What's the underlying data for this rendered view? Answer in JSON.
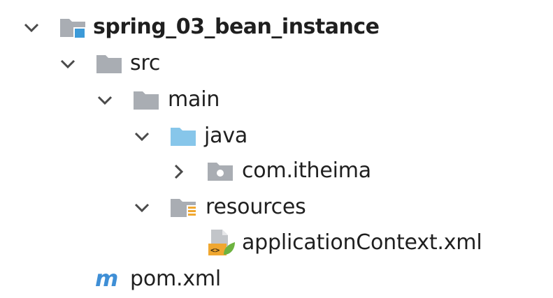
{
  "tree": {
    "root": {
      "label": "spring_03_bean_instance",
      "expanded": true,
      "icon": "module-folder-icon"
    },
    "src": {
      "label": "src",
      "expanded": true,
      "icon": "folder-icon"
    },
    "main": {
      "label": "main",
      "expanded": true,
      "icon": "folder-icon"
    },
    "java": {
      "label": "java",
      "expanded": true,
      "icon": "source-root-folder-icon"
    },
    "package": {
      "label": "com.itheima",
      "expanded": false,
      "icon": "package-icon"
    },
    "resources": {
      "label": "resources",
      "expanded": true,
      "icon": "resources-root-folder-icon"
    },
    "app_context": {
      "label": "applicationContext.xml",
      "icon": "spring-xml-file-icon"
    },
    "pom": {
      "label": "pom.xml",
      "icon": "maven-icon"
    }
  },
  "colors": {
    "folder_gray": "#a9adb3",
    "source_root_blue": "#87c6ea",
    "module_accent": "#3c9ad8",
    "maven_blue": "#3f8fd6",
    "resources_orange": "#f0a730",
    "spring_green": "#6db33f",
    "text": "#1f1f1f",
    "arrow": "#4a4a4a"
  }
}
